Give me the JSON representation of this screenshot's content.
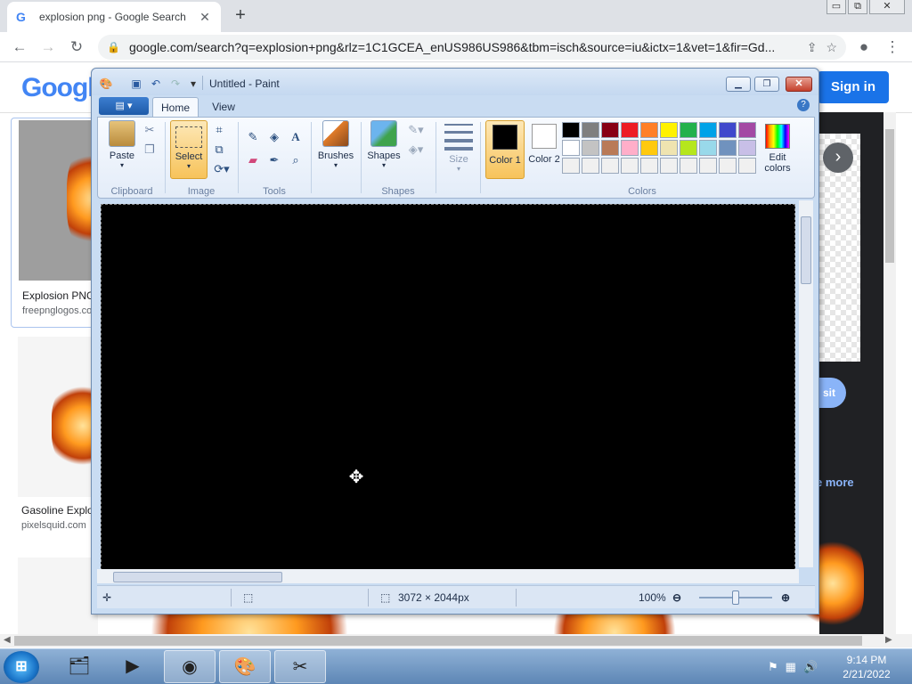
{
  "browser": {
    "tab_title": "explosion png - Google Search",
    "tab_close": "✕",
    "new_tab": "+",
    "url": "google.com/search?q=explosion+png&rlz=1C1GCEA_enUS986US986&tbm=isch&source=iu&ictx=1&vet=1&fir=Gd...",
    "window_controls": [
      "▭",
      "⧉",
      "✕"
    ]
  },
  "google": {
    "logo_text": "Googl",
    "sign_in": "Sign in",
    "results": [
      {
        "title": "Explosion PNG",
        "source": "freepnglogos.com"
      },
      {
        "title": "Gasoline Explo",
        "source": "pixelsquid.com"
      }
    ],
    "preview": {
      "visit_label": "sit",
      "see_more": "e more"
    }
  },
  "paint": {
    "title": "Untitled - Paint",
    "tabs": [
      "Home",
      "View"
    ],
    "groups": {
      "clipboard": "Clipboard",
      "image": "Image",
      "tools": "Tools",
      "shapes": "Shapes",
      "colors": "Colors"
    },
    "buttons": {
      "paste": "Paste",
      "select": "Select",
      "brushes": "Brushes",
      "shapes": "Shapes",
      "size": "Size",
      "color1": "Color 1",
      "color2": "Color 2",
      "edit_colors": "Edit colors"
    },
    "colors": {
      "color1": "#000000",
      "color2": "#ffffff",
      "palette": [
        "#000000",
        "#7f7f7f",
        "#880015",
        "#ed1c24",
        "#ff7f27",
        "#fff200",
        "#22b14c",
        "#00a2e8",
        "#3f48cc",
        "#a349a4",
        "#ffffff",
        "#c3c3c3",
        "#b97a57",
        "#ffaec9",
        "#ffc90e",
        "#efe4b0",
        "#b5e61d",
        "#99d9ea",
        "#7092be",
        "#c8bfe7",
        "#f0f0f0",
        "#f0f0f0",
        "#f0f0f0",
        "#f0f0f0",
        "#f0f0f0",
        "#f0f0f0",
        "#f0f0f0",
        "#f0f0f0",
        "#f0f0f0",
        "#f0f0f0"
      ]
    },
    "status": {
      "image_size": "3072 × 2044px",
      "zoom": "100%"
    }
  },
  "taskbar": {
    "time": "9:14 PM",
    "date": "2/21/2022"
  }
}
